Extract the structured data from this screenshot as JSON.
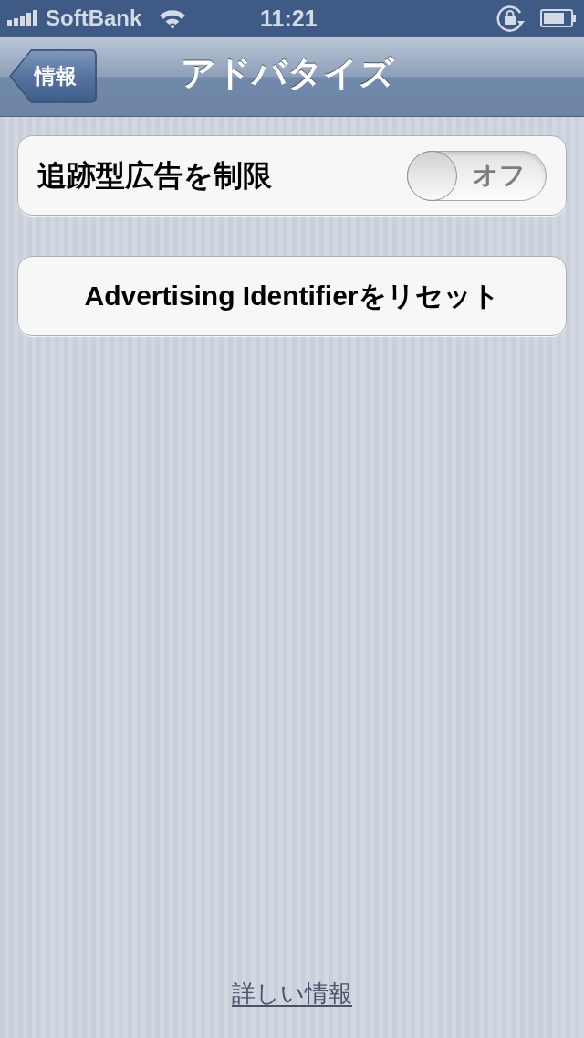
{
  "status_bar": {
    "carrier": "SoftBank",
    "time": "11:21"
  },
  "nav_bar": {
    "back_button": "情報",
    "title": "アドバタイズ"
  },
  "settings": [
    {
      "kind": "toggle",
      "label": "追跡型広告を制限",
      "on": false,
      "state_label": "オフ"
    },
    {
      "kind": "button",
      "label": "Advertising Identifierをリセット"
    }
  ],
  "footer_link": "詳しい情報"
}
